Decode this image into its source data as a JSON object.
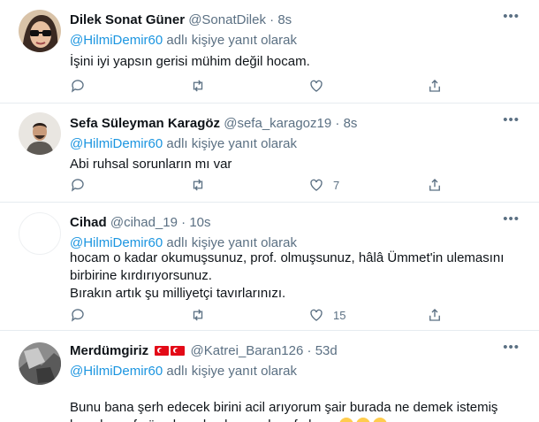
{
  "tweets": [
    {
      "name": "Dilek Sonat Güner",
      "handle": "@SonatDilek",
      "dot": "·",
      "time": "8s",
      "reply_prefix": "@HilmiDemir60",
      "reply_suffix": " adlı kişiye yanıt olarak",
      "text": "İşini iyi yapsın gerisi mühim değil hocam.",
      "like_count": "",
      "avatar": "sunglasses-woman-avatar"
    },
    {
      "name": "Sefa Süleyman Karagöz",
      "handle": "@sefa_karagoz19",
      "dot": "·",
      "time": "8s",
      "reply_prefix": "@HilmiDemir60",
      "reply_suffix": " adlı kişiye yanıt olarak",
      "text": "Abi ruhsal sorunların mı var",
      "like_count": "7",
      "avatar": "man-avatar"
    },
    {
      "name": "Cihad",
      "handle": "@cihad_19",
      "dot": "·",
      "time": "10s",
      "reply_prefix": "@HilmiDemir60",
      "reply_suffix": " adlı kişiye yanıt olarak",
      "text": "hocam o kadar okumuşsunuz, prof. olmuşsunuz, hâlâ Ümmet'in ulemasını\nbirbirine kırdırıyorsunuz.\nBırakın artık şu milliyetçi tavırlarınızı.",
      "like_count": "15",
      "avatar": "blank-avatar"
    },
    {
      "name": "Merdümgiriz",
      "handle": "@Katrei_Baran126",
      "dot": "·",
      "time": "53d",
      "reply_prefix": "@HilmiDemir60",
      "reply_suffix": " adlı kişiye yanıt olarak",
      "text": "Bunu bana şerh edecek birini acil arıyorum şair burada ne demek istemiş\nhemde prof güya bu adamlar nasıl prof olmuş",
      "like_count": "",
      "avatar": "bw-photo-avatar",
      "flags": [
        "turkey-flag",
        "turkey-flag"
      ],
      "emojis": [
        "thinking-face",
        "thinking-face",
        "thinking-face"
      ]
    }
  ],
  "more_label": "•••",
  "colors": {
    "link": "#1b95e0",
    "muted": "#5b7083",
    "text": "#0f1419",
    "divider": "#e6ecf0"
  }
}
